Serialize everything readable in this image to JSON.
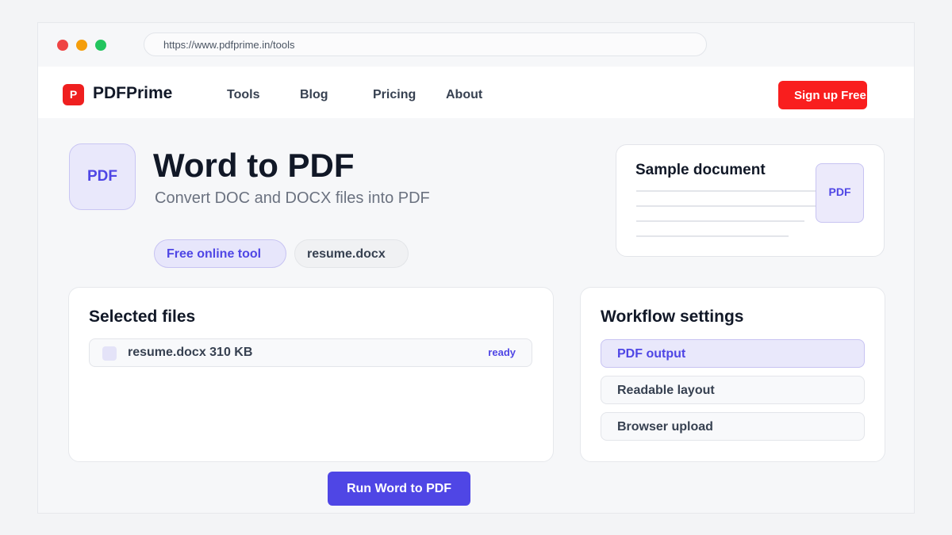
{
  "browser": {
    "url": "https://www.pdfprime.in/tools"
  },
  "nav": {
    "logo_mark": "P",
    "logo_text": "PDFPrime",
    "links": [
      "Tools",
      "Blog",
      "Pricing",
      "About"
    ],
    "signup_label": "Sign up Free"
  },
  "hero": {
    "badge": "PDF",
    "title": "Word to PDF",
    "subtitle": "Convert DOC and DOCX files into PDF",
    "pills": [
      "Free online tool",
      "resume.docx"
    ]
  },
  "sample": {
    "title": "Sample document",
    "badge": "PDF"
  },
  "files": {
    "title": "Selected files",
    "items": [
      {
        "name": "resume.docx 310 KB",
        "status": "ready"
      }
    ]
  },
  "settings": {
    "title": "Workflow settings",
    "options": [
      {
        "label": "PDF output",
        "active": true
      },
      {
        "label": "Readable layout",
        "active": false
      },
      {
        "label": "Browser upload",
        "active": false
      }
    ]
  },
  "run_label": "Run Word to PDF",
  "colors": {
    "brand_red": "#f91e1e",
    "accent": "#4f46e5",
    "accent_light": "#e9e8fb"
  }
}
